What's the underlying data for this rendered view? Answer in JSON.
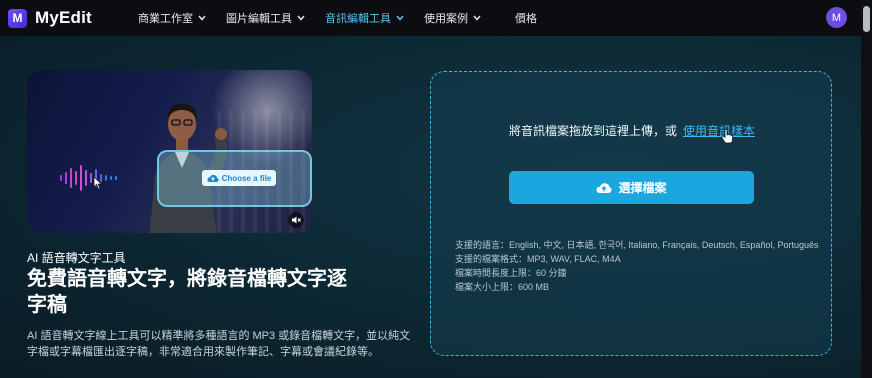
{
  "brand": {
    "name": "MyEdit",
    "logo_letter": "M",
    "accent": "#6c4ee0"
  },
  "nav": {
    "items": [
      {
        "label": "商業工作室",
        "dropdown": true,
        "active": false
      },
      {
        "label": "圖片編輯工具",
        "dropdown": true,
        "active": false
      },
      {
        "label": "音訊編輯工具",
        "dropdown": true,
        "active": true
      },
      {
        "label": "使用案例",
        "dropdown": true,
        "active": false
      },
      {
        "label": "價格",
        "dropdown": false,
        "active": false
      }
    ],
    "avatar_letter": "M"
  },
  "hero": {
    "choose_file_label": "Choose a file",
    "mute_icon": "speaker-muted-icon"
  },
  "main": {
    "tag": "AI 語音轉文字工具",
    "headline": "免費語音轉文字，將錄音檔轉文字逐字稿",
    "description": "AI 語音轉文字線上工具可以精準將多種語言的 MP3 或錄音檔轉文字，並以純文字檔或字幕檔匯出逐字稿，非常適合用來製作筆記、字幕或會議紀錄等。"
  },
  "upload": {
    "drop_text": "將音訊檔案拖放到這裡上傳，或",
    "sample_link": "使用音訊樣本",
    "select_button": "選擇檔案",
    "info_lines": [
      "支援的語言：English, 中文, 日本語, 한국어, Italiano, Français, Deutsch, Español, Português",
      "支援的檔案格式：MP3, WAV, FLAC, M4A",
      "檔案時間長度上限：60 分鐘",
      "檔案大小上限：600 MB"
    ],
    "accent": "#1aa7e0"
  }
}
